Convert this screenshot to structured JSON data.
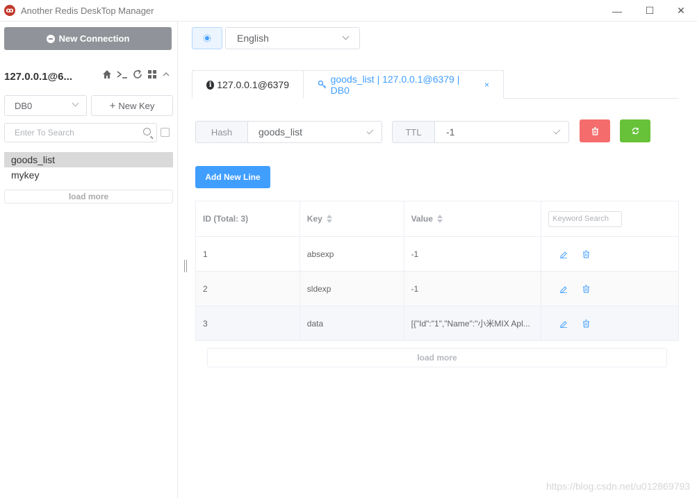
{
  "window": {
    "title": "Another Redis DeskTop Manager",
    "icon": "redis-logo-icon",
    "controls": {
      "minimize": "—",
      "maximize": "☐",
      "close": "✕"
    }
  },
  "sidebar": {
    "new_connection": "New Connection",
    "connection_name": "127.0.0.1@6...",
    "db_select": "DB0",
    "new_key": "New Key",
    "search_placeholder": "Enter To Search",
    "keys": [
      "goods_list",
      "mykey"
    ],
    "active_key": "goods_list",
    "load_more": "load more"
  },
  "toolbar": {
    "language": "English"
  },
  "tabs": [
    {
      "label": "127.0.0.1@6379",
      "icon": "info-icon"
    },
    {
      "label": "goods_list | 127.0.0.1@6379 | DB0",
      "icon": "key-icon",
      "close": "×"
    }
  ],
  "key_detail": {
    "type": "Hash",
    "key_name": "goods_list",
    "ttl_label": "TTL",
    "ttl_value": "-1",
    "add_new_line": "Add New Line"
  },
  "table": {
    "headers": [
      "ID (Total: 3)",
      "Key",
      "Value"
    ],
    "keyword_placeholder": "Keyword Search",
    "rows": [
      {
        "id": "1",
        "key": "absexp",
        "value": "-1"
      },
      {
        "id": "2",
        "key": "sldexp",
        "value": "-1"
      },
      {
        "id": "3",
        "key": "data",
        "value": "[{\"Id\":\"1\",\"Name\":\"小米MIX Apl..."
      }
    ],
    "load_more": "load more"
  },
  "watermark": "https://blog.csdn.net/u012869793",
  "colors": {
    "primary": "#409eff",
    "danger": "#f56c6c",
    "success": "#67c23a",
    "info": "#909399"
  }
}
